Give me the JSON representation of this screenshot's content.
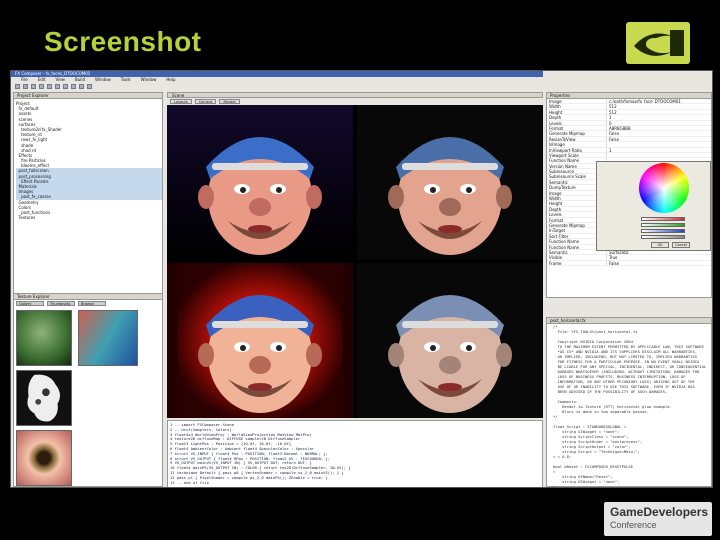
{
  "slide": {
    "title": "Screenshot",
    "brand_color": "#b7d13a"
  },
  "logos": {
    "gdc_line1": "GameDevelopers",
    "gdc_line2": "Conference"
  },
  "window": {
    "title": "FX Composer - fx_faces_DTOOCOM01",
    "menu": [
      "File",
      "Edit",
      "View",
      "Build",
      "Window",
      "Tools",
      "Window",
      "Help"
    ]
  },
  "project_explorer": {
    "title": "Project Explorer",
    "items": [
      "Project",
      "  fx_default",
      "  assets",
      "  scenes",
      "  surfaces",
      "    texture2d fx_Shader",
      "    texture_rd",
      "    rows_fx_light",
      "    shade",
      "    shad rd",
      "  Effects",
      "    fire Particles",
      "    blooms_effect",
      "  post_fullscreen",
      "  post_processing",
      "    Effect Params",
      "  Materials",
      "  Images",
      "    post_fx_coarse",
      "  Geometry",
      "  Colors",
      "    post_functions",
      "  Textures"
    ]
  },
  "texture_explorer": {
    "title": "Texture Explorer",
    "tabs": [
      "Gallery",
      "Thumbnails",
      "Browse"
    ]
  },
  "scene": {
    "title": "Scene",
    "tabs": [
      "Layouts",
      "Camera",
      "Render"
    ]
  },
  "editor": {
    "lines": [
      "1  -- import FXComposer.Scene",
      "2  -- dict(Samplers, Colors)",
      "3  float4x4 WorldViewProj : WorldViewProjection  MatView  MatProj",
      "4  texture2D diffuseMap : DIFFUSE  sampler2D DiffuseSampler",
      "5  float3 LightPos : Position = {10.0f, 10.0f, -10.0f}",
      "6  float4 AmbientColor : Ambient  float4 SpecularColor : Specular",
      "7  struct VS_INPUT { float4 Pos : POSITION; float3 Normal : NORMAL; };",
      "8  struct VS_OUTPUT { float4 HPos : POSITION; float2 UV : TEXCOORD0; };",
      "9  VS_OUTPUT mainVS(VS_INPUT IN) { VS_OUTPUT OUT; return OUT; }",
      "10 float4 mainPS(VS_OUTPUT IN) : COLOR { return tex2D(DiffuseSampler, IN.UV); }",
      "11 technique Default { pass p0 { VertexShader = compile vs_2_0 mainVS(); } }",
      "12 pass p1 { PixelShader = compile ps_2_0 mainPS(); ZEnable = true; }",
      "13 -- end of file"
    ]
  },
  "properties": {
    "title": "Properties",
    "rows": [
      {
        "k": "Image",
        "v": "c:/path/fxmap/fx_face_DTOOCOM01"
      },
      {
        "k": "Width",
        "v": "512"
      },
      {
        "k": "Height",
        "v": "512"
      },
      {
        "k": "Depth",
        "v": "1"
      },
      {
        "k": "Levels",
        "v": "0"
      },
      {
        "k": "Format",
        "v": "A8R8G8B8"
      },
      {
        "k": "Generate Mipmap",
        "v": "False"
      },
      {
        "k": "ResizeToView",
        "v": "False"
      },
      {
        "k": "IsImage",
        "v": ""
      },
      {
        "k": "InViewport Ratio",
        "v": "1"
      },
      {
        "k": "Viewport Scale",
        "v": ""
      },
      {
        "k": "Function Name",
        "v": ""
      },
      {
        "k": "Version Name",
        "v": ""
      },
      {
        "k": "Subresource",
        "v": ""
      },
      {
        "k": "Subresource Scale",
        "v": ""
      },
      {
        "k": "Semantic",
        "v": ""
      },
      {
        "k": "DumpTexture",
        "v": ""
      },
      {
        "k": "Image",
        "v": ""
      },
      {
        "k": "Width",
        "v": ""
      },
      {
        "k": "Height",
        "v": ""
      },
      {
        "k": "Depth",
        "v": ""
      },
      {
        "k": "Levels",
        "v": ""
      },
      {
        "k": "Format",
        "v": ""
      },
      {
        "k": "Generate Mipmap",
        "v": ""
      },
      {
        "k": "InTarget",
        "v": ""
      },
      {
        "k": "Sort Filter",
        "v": ""
      },
      {
        "k": "Function Name",
        "v": ""
      },
      {
        "k": "Function Name",
        "v": ""
      },
      {
        "k": "Semantic",
        "v": "SurfaceID"
      },
      {
        "k": "Visible",
        "v": "True"
      },
      {
        "k": "Frame",
        "v": "False"
      }
    ],
    "dialog_buttons": [
      "OK",
      "Cancel"
    ],
    "slider_colors": [
      "#d03030",
      "#2a9a30",
      "#2040c0",
      "#888888"
    ]
  },
  "shader": {
    "title": "post_horizontal.fx",
    "lines": [
      "/*",
      "  File: %FX_TOOLS%/post_horizontal.fx",
      "",
      "  Copyright NVIDIA Corporation 2004",
      "  TO THE MAXIMUM EXTENT PERMITTED BY APPLICABLE LAW, THIS SOFTWARE",
      "  *AS IS* AND NVIDIA AND ITS SUPPLIERS DISCLAIM ALL WARRANTIES,",
      "  OR IMPLIED, INCLUDING, BUT NOT LIMITED TO, IMPLIED WARRANTIES",
      "  FOR FITNESS FOR A PARTICULAR PURPOSE. IN NO EVENT SHALL NVIDIA",
      "  BE LIABLE FOR ANY SPECIAL, INCIDENTAL, INDIRECT, OR CONSEQUENTIAL",
      "  DAMAGES WHATSOEVER (INCLUDING, WITHOUT LIMITATION, DAMAGES FOR",
      "  LOSS OF BUSINESS PROFITS, BUSINESS INTERRUPTION, LOSS OF",
      "  INFORMATION, OR ANY OTHER PECUNIARY LOSS) ARISING OUT OF THE",
      "  USE OF OR INABILITY TO USE THIS SOFTWARE, EVEN IF NVIDIA HAS",
      "  BEEN ADVISED OF THE POSSIBILITY OF SUCH DAMAGES.",
      "",
      "  Comments:",
      "    Render-to-Texture (RTT) horizontal glow example.",
      "    Blurs is done in two separable passes.",
      "*/",
      "",
      "float Script : STANDARDSGLOBAL <",
      "    string UIWidget = \"none\";",
      "    string ScriptClass = \"scene\";",
      "    string ScriptOrder = \"postprocess\";",
      "    string ScriptOutput = \"color\";",
      "    string Script = \"Technique=Main;\";",
      "> = 0.8;",
      "",
      "bool bReset : FXCOMPOSER_RESETPULSE",
      "<",
      "    string UIName=\"Reset\";",
      "    string UIWidget = \"none\";",
      ">;"
    ]
  }
}
